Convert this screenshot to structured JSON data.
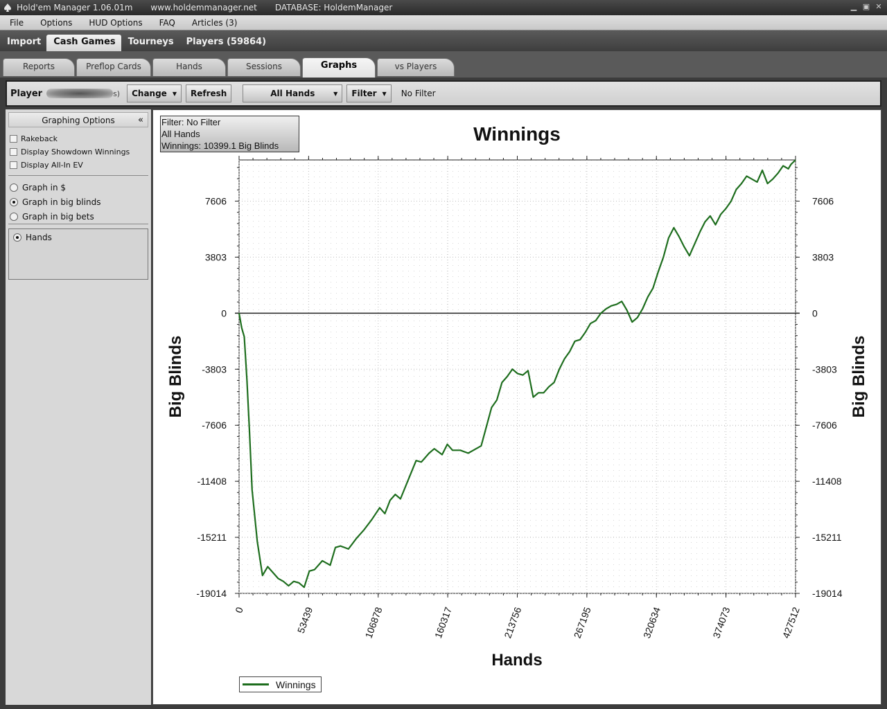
{
  "window": {
    "app_title": "Hold'em Manager 1.06.01m",
    "site": "www.holdemmanager.net",
    "database": "DATABASE: HoldemManager"
  },
  "menu": [
    "File",
    "Options",
    "HUD Options",
    "FAQ",
    "Articles (3)"
  ],
  "main_tabs": [
    "Import",
    "Cash Games",
    "Tourneys",
    "Players (59864)"
  ],
  "main_tab_active": "Cash Games",
  "sub_tabs": [
    "Reports",
    "Preflop Cards",
    "Hands",
    "Sessions",
    "Graphs",
    "vs Players"
  ],
  "sub_tab_active": "Graphs",
  "toolbar": {
    "player_label": "Player",
    "player_suffix": "s)",
    "change_label": "Change",
    "refresh_label": "Refresh",
    "hands_select": "All Hands",
    "filter_label": "Filter",
    "filter_status": "No Filter"
  },
  "graphing_options": {
    "title": "Graphing Options",
    "collapse_glyph": "«",
    "checkboxes": [
      {
        "label": "Rakeback",
        "checked": false
      },
      {
        "label": "Display Showdown Winnings",
        "checked": false
      },
      {
        "label": "Display All-In EV",
        "checked": false
      }
    ],
    "units": [
      {
        "label": "Graph in $",
        "selected": false
      },
      {
        "label": "Graph in big blinds",
        "selected": true
      },
      {
        "label": "Graph in big bets",
        "selected": false
      }
    ],
    "axis_mode": [
      {
        "label": "Hands",
        "selected": true
      }
    ]
  },
  "info_box": {
    "line1": "Filter: No Filter",
    "line2": "All Hands",
    "line3": "Winnings: 10399.1 Big Blinds"
  },
  "chart_data": {
    "type": "line",
    "title": "Winnings",
    "xlabel": "Hands",
    "ylabel": "Big Blinds",
    "xlim": [
      0,
      427512
    ],
    "ylim": [
      -19014,
      10400
    ],
    "x_ticks": [
      0,
      53439,
      106878,
      160317,
      213756,
      267195,
      320634,
      374073,
      427512
    ],
    "y_ticks": [
      7606,
      3803,
      0,
      -3803,
      -7606,
      -11408,
      -15211,
      -19014
    ],
    "grid": true,
    "legend_position": "bottom-left",
    "series": [
      {
        "name": "Winnings",
        "color": "#1d6d1d",
        "x": [
          0,
          2000,
          4000,
          6000,
          8000,
          10000,
          14000,
          18000,
          22000,
          26000,
          30000,
          34000,
          38000,
          42000,
          46000,
          50000,
          54000,
          58000,
          64000,
          70000,
          74000,
          78000,
          84000,
          90000,
          96000,
          102000,
          108000,
          112000,
          116000,
          120000,
          124000,
          130000,
          136000,
          140000,
          146000,
          150000,
          156000,
          160000,
          164000,
          170000,
          176000,
          180000,
          186000,
          190000,
          194000,
          198000,
          202000,
          206000,
          210000,
          214000,
          218000,
          222000,
          226000,
          230000,
          234000,
          238000,
          242000,
          246000,
          250000,
          254000,
          258000,
          262000,
          266000,
          270000,
          274000,
          278000,
          282000,
          286000,
          290000,
          294000,
          298000,
          302000,
          306000,
          310000,
          314000,
          318000,
          322000,
          326000,
          330000,
          334000,
          338000,
          342000,
          346000,
          350000,
          354000,
          358000,
          362000,
          366000,
          370000,
          374000,
          378000,
          382000,
          386000,
          390000,
          394000,
          398000,
          402000,
          406000,
          410000,
          414000,
          418000,
          422000,
          424000,
          427512
        ],
        "values": [
          0,
          -1000,
          -1600,
          -4500,
          -8000,
          -12000,
          -15500,
          -17800,
          -17200,
          -17600,
          -18000,
          -18200,
          -18500,
          -18200,
          -18300,
          -18600,
          -17500,
          -17400,
          -16800,
          -17100,
          -15900,
          -15800,
          -16000,
          -15300,
          -14700,
          -14000,
          -13200,
          -13600,
          -12700,
          -12300,
          -12600,
          -11300,
          -10000,
          -10100,
          -9500,
          -9200,
          -9600,
          -8900,
          -9300,
          -9300,
          -9500,
          -9300,
          -9000,
          -7700,
          -6400,
          -5900,
          -4700,
          -4300,
          -3800,
          -4100,
          -4200,
          -3900,
          -5700,
          -5400,
          -5400,
          -5000,
          -4700,
          -3800,
          -3100,
          -2600,
          -1900,
          -1800,
          -1300,
          -700,
          -500,
          0,
          300,
          500,
          600,
          800,
          200,
          -600,
          -300,
          300,
          1100,
          1700,
          2800,
          3800,
          5100,
          5800,
          5200,
          4500,
          3900,
          4700,
          5500,
          6200,
          6600,
          6000,
          6700,
          7100,
          7600,
          8400,
          8800,
          9300,
          9100,
          8900,
          9700,
          8800,
          9100,
          9500,
          10000,
          9800,
          10100,
          10400
        ]
      }
    ]
  }
}
